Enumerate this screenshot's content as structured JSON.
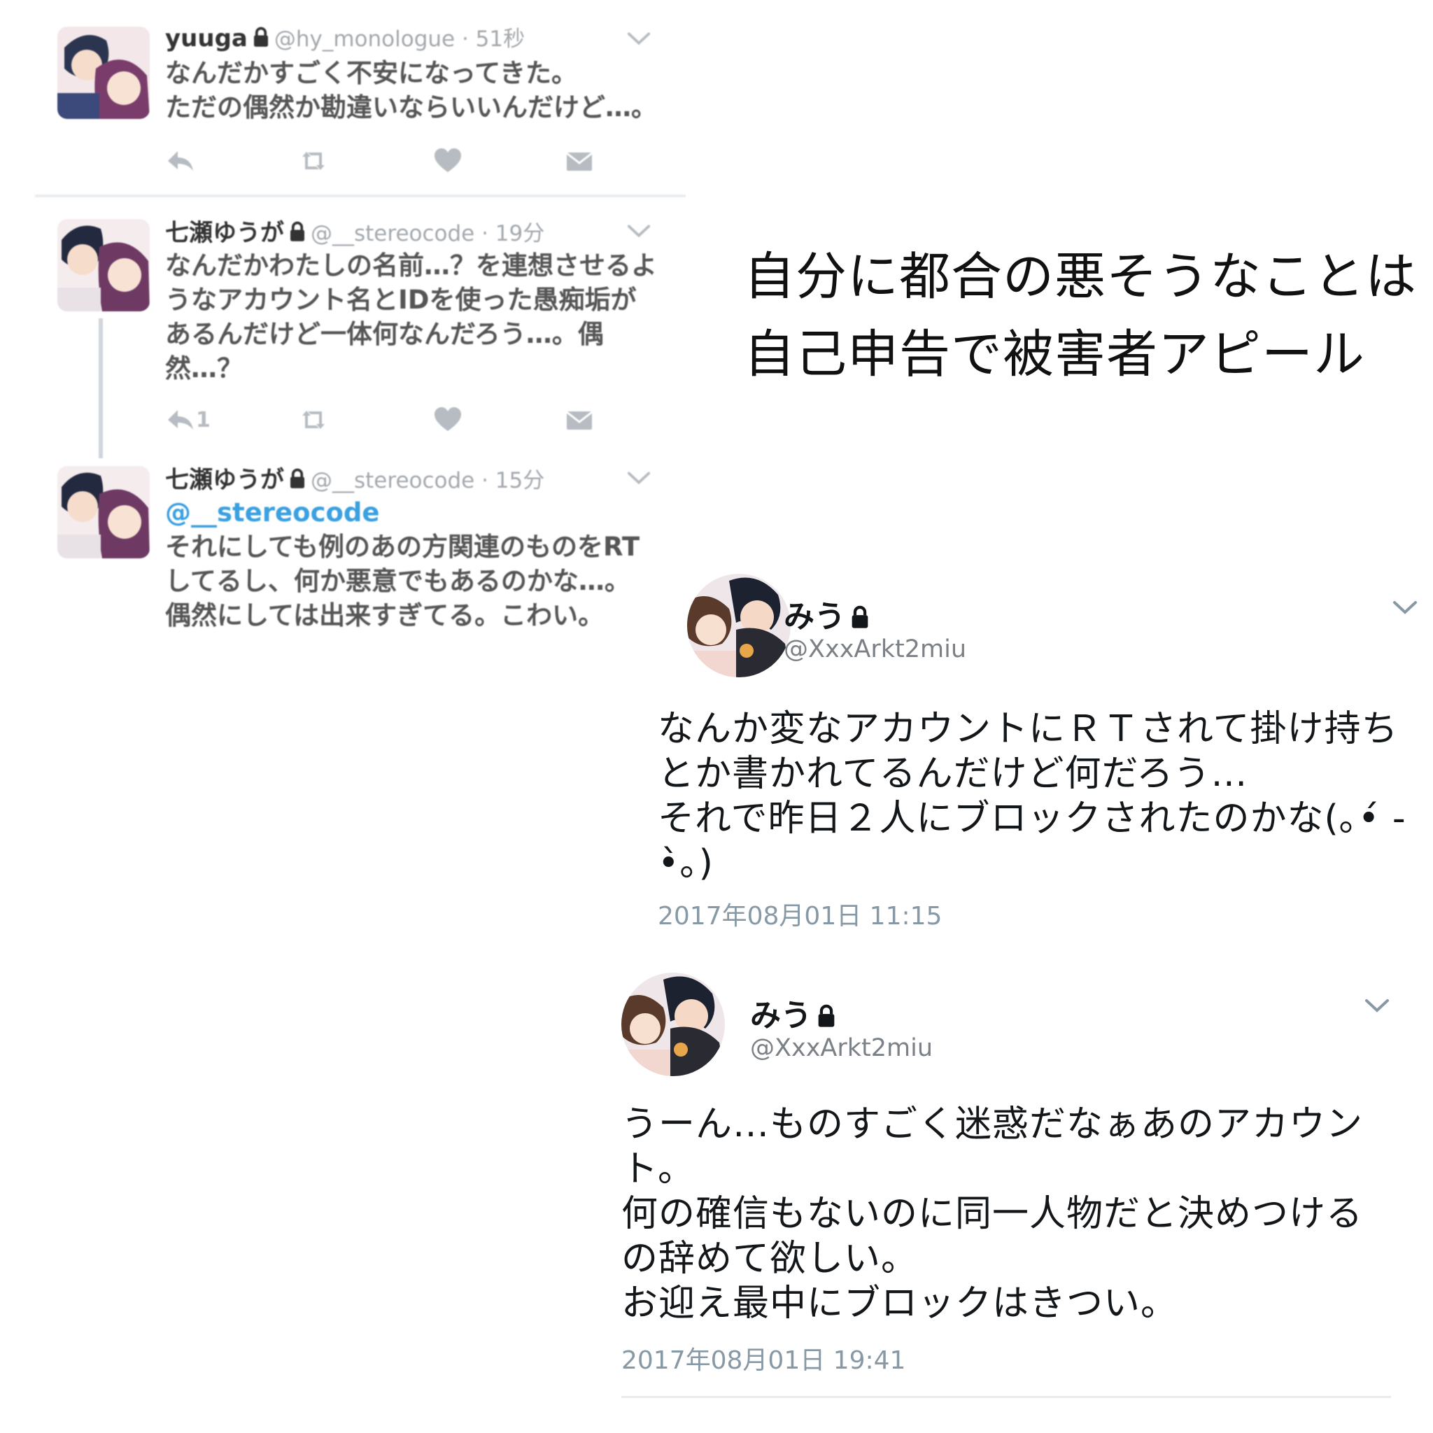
{
  "left_tweets": [
    {
      "name": "yuuga",
      "meta": "@hy_monologue · 51秒",
      "lines": [
        "なんだかすごく不安になってきた。",
        "ただの偶然か勘違いならいいんだけど…。"
      ],
      "reply_count": ""
    },
    {
      "name": "七瀬ゆうが",
      "meta": "@__stereocode · 19分",
      "lines": [
        "なんだかわたしの名前…？を連想させるよ",
        "うなアカウント名とIDを使った愚痴垢が",
        "あるんだけど一体何なんだろう…。偶",
        "然…？"
      ],
      "reply_count": "1"
    },
    {
      "name": "七瀬ゆうが",
      "meta": "@__stereocode · 15分",
      "mention": "@__stereocode",
      "lines": [
        "それにしても例のあの方関連のものをRT",
        "してるし、何か悪意でもあるのかな…。",
        "偶然にしては出来すぎてる。こわい。"
      ]
    }
  ],
  "caption": "自分に都合の悪そうなことは\n自己申告で被害者アピール",
  "right_tweets": [
    {
      "name": "みう",
      "handle": "@XxxArkt2miu",
      "text": "なんか変なアカウントにＲＴされて掛け持ち\nとか書かれてるんだけど何だろう…\nそれで昨日２人にブロックされたのかな(｡•́ -\n•̀｡)",
      "time": "2017年08月01日 11:15"
    },
    {
      "name": "みう",
      "handle": "@XxxArkt2miu",
      "text": "うーん…ものすごく迷惑だなぁあのアカウン\nト。\n何の確信もないのに同一人物だと決めつける\nの辞めて欲しい。\nお迎え最中にブロックはきつい。",
      "time": "2017年08月01日 19:41"
    }
  ],
  "icons": [
    "lock-icon",
    "reply-icon",
    "retweet-icon",
    "like-icon",
    "dm-icon",
    "chevron-down-icon"
  ],
  "colors": {
    "link": "#3aa0e0",
    "muted": "#a3a8ad",
    "time": "#8899a6",
    "divider": "#e9edef"
  }
}
